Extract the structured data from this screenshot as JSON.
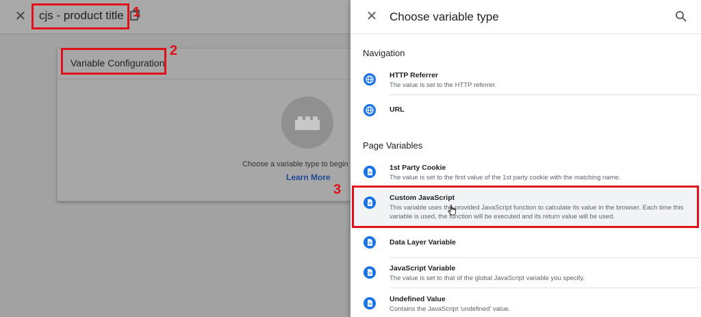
{
  "editor": {
    "title": "cjs - product title",
    "config_card": {
      "title": "Variable Configuration",
      "hint": "Choose a variable type to begin s",
      "learn_more": "Learn More"
    }
  },
  "panel": {
    "title": "Choose variable type",
    "sections": [
      {
        "title": "Navigation",
        "items": [
          {
            "name": "HTTP Referrer",
            "description": "The value is set to the HTTP referrer.",
            "icon": "globe-icon"
          },
          {
            "name": "URL",
            "description": "",
            "icon": "globe-icon"
          }
        ]
      },
      {
        "title": "Page Variables",
        "items": [
          {
            "name": "1st Party Cookie",
            "description": "The value is set to the first value of the 1st party cookie with the matching name.",
            "icon": "document-icon"
          },
          {
            "name": "Custom JavaScript",
            "description": "This variable uses the provided JavaScript function to calculate its value in the browser. Each time this variable is used, the function will be executed and its return value will be used.",
            "icon": "document-icon"
          },
          {
            "name": "Data Layer Variable",
            "description": "",
            "icon": "document-icon"
          },
          {
            "name": "JavaScript Variable",
            "description": "The value is set to that of the global JavaScript variable you specify.",
            "icon": "document-icon"
          },
          {
            "name": "Undefined Value",
            "description": "Contains the JavaScript 'undefined' value.",
            "icon": "document-icon"
          }
        ]
      }
    ]
  },
  "annotations": [
    "1",
    "2",
    "3"
  ],
  "colors": {
    "accent": "#1a73e8",
    "annotation": "#e0101a"
  }
}
